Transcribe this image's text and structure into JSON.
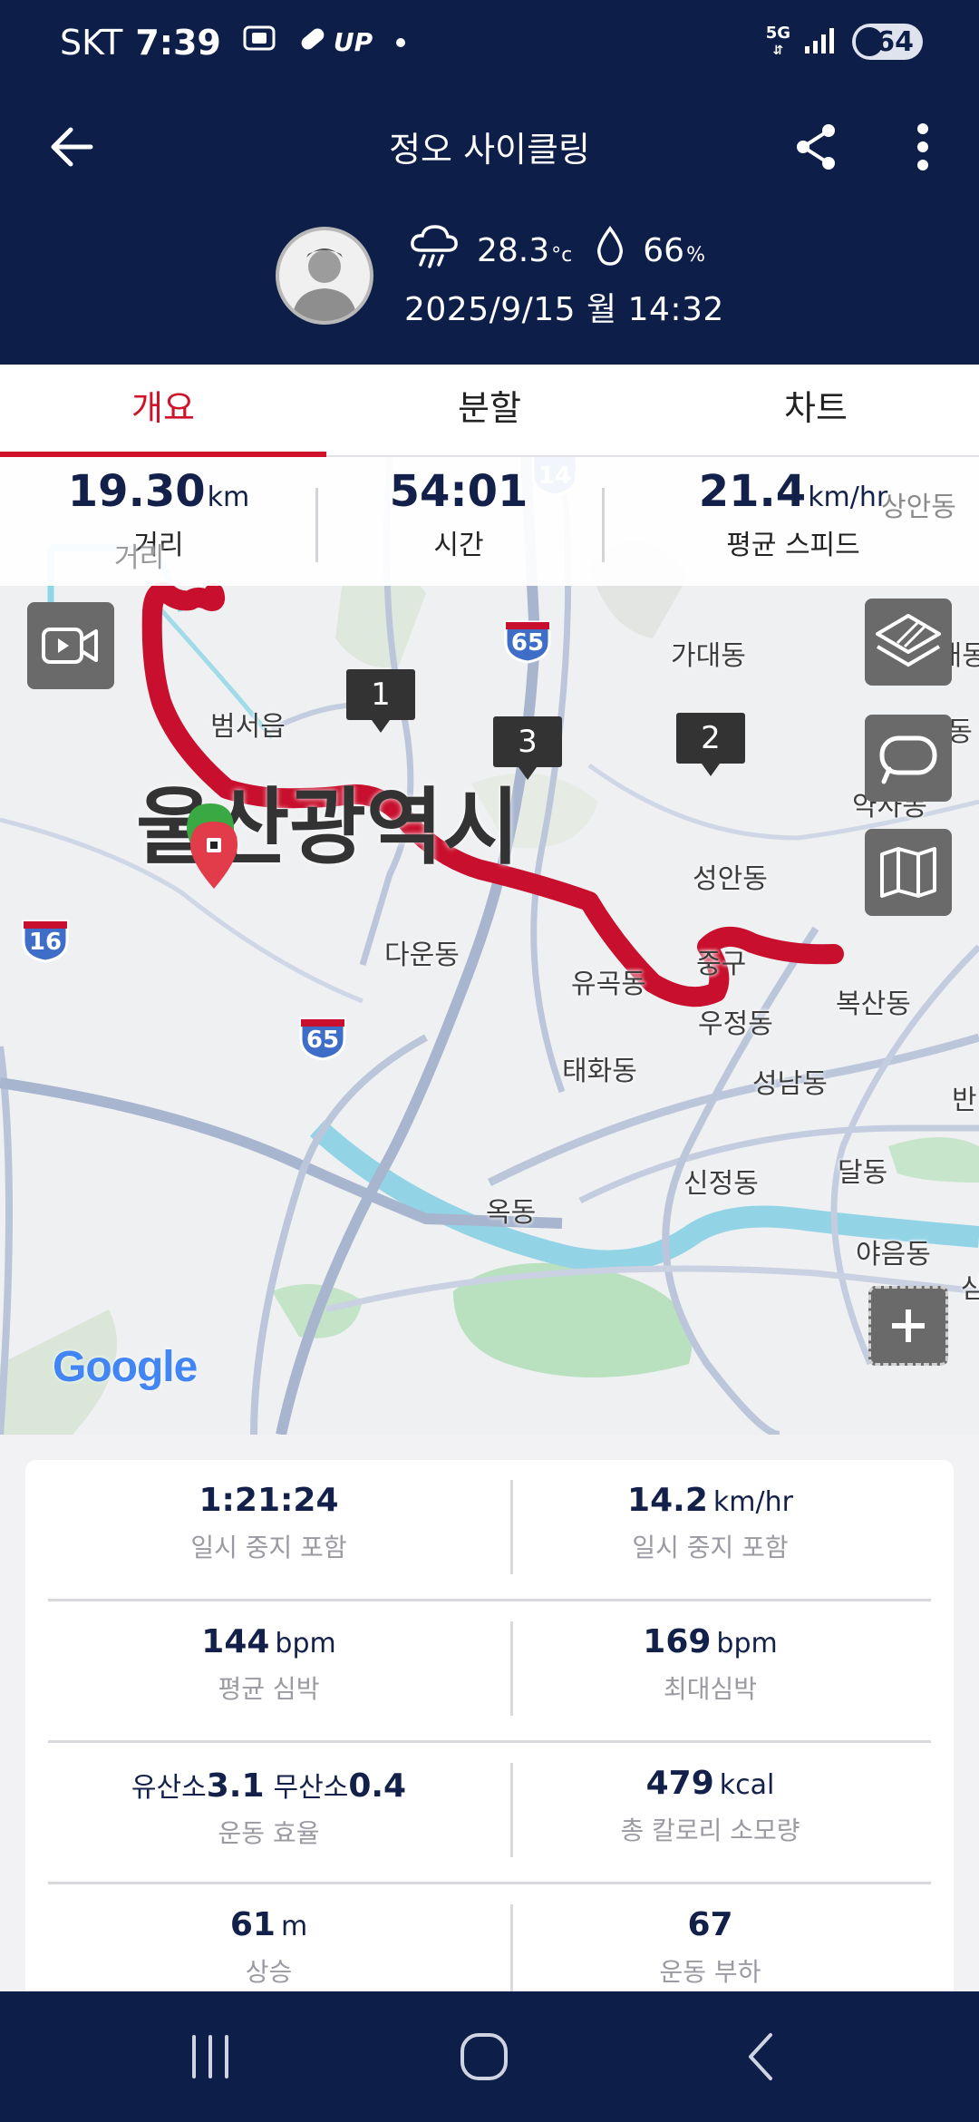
{
  "status_bar": {
    "carrier": "SKT",
    "time": "7:39",
    "network": "5G",
    "battery": "64",
    "icons": [
      "screenshot-icon",
      "pill-icon",
      "uplus-icon",
      "notification-dot",
      "signal-icon"
    ],
    "uplus_label": "UP"
  },
  "header": {
    "title": "정오 사이클링",
    "weather_icon": "rain-cloud-icon",
    "temperature": "28.3",
    "temperature_unit": "°c",
    "humidity_icon": "droplet-icon",
    "humidity": "66",
    "humidity_unit": "%",
    "datetime": "2025/9/15 월 14:32"
  },
  "tabs": [
    {
      "label": "개요",
      "active": true
    },
    {
      "label": "분할",
      "active": false
    },
    {
      "label": "차트",
      "active": false
    }
  ],
  "summary": {
    "distance": {
      "value": "19.30",
      "unit": "km",
      "label": "거리"
    },
    "time": {
      "value": "54:01",
      "label": "시간"
    },
    "speed": {
      "value": "21.4",
      "unit": "km/hr",
      "label": "평균 스피드"
    }
  },
  "map": {
    "city_label": "울산광역시",
    "labels": [
      "상안동",
      "거리",
      "가대동",
      "범서읍",
      "성안동",
      "다운동",
      "유곡동",
      "중구",
      "우정동",
      "복산동",
      "태화동",
      "성남동",
      "신정동",
      "달동",
      "옥동",
      "야음동",
      "약사동",
      "장현동",
      "송대동",
      "반",
      "삼"
    ],
    "highway_shields": [
      "14",
      "65",
      "16",
      "65"
    ],
    "lap_markers": [
      "1",
      "3",
      "2"
    ],
    "google_logo": "Google",
    "route_color": "#c8102e",
    "buttons": [
      "video-camera-icon",
      "map-layer-icon",
      "route-loop-icon",
      "map-book-icon",
      "zoom-in-icon"
    ]
  },
  "stats": [
    {
      "left": {
        "value": "1:21:24",
        "unit": "",
        "label": "일시 중지 포함"
      },
      "right": {
        "value": "14.2",
        "unit": "km/hr",
        "label": "일시 중지 포함"
      }
    },
    {
      "left": {
        "value": "144",
        "unit": "bpm",
        "label": "평균 심박"
      },
      "right": {
        "value": "169",
        "unit": "bpm",
        "label": "최대심박"
      }
    },
    {
      "left": {
        "aerobic_label": "유산소",
        "aerobic_value": "3.1",
        "anaerobic_label": "무산소",
        "anaerobic_value": "0.4",
        "label": "운동 효율"
      },
      "right": {
        "value": "479",
        "unit": "kcal",
        "label": "총 칼로리 소모량"
      }
    },
    {
      "left": {
        "value": "61",
        "unit": "m",
        "label": "상승"
      },
      "right": {
        "value": "67",
        "unit": "",
        "label": "운동 부하"
      }
    }
  ],
  "colors": {
    "header_bg": "#0d1e49",
    "accent_red": "#d0132a",
    "value_text": "#13204a"
  },
  "nav": [
    "recent-apps-icon",
    "home-icon",
    "back-icon"
  ]
}
